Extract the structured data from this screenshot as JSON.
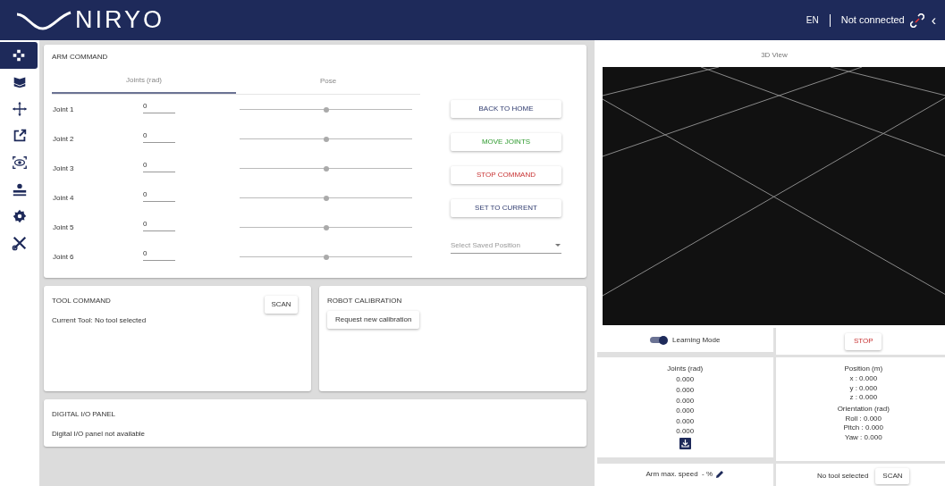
{
  "header": {
    "logo": "NIRYO",
    "language": "EN",
    "status": "Not connected",
    "collapse": "‹"
  },
  "sidebar": {
    "items": [
      {
        "selected": true
      },
      {
        "selected": false
      },
      {
        "selected": false
      },
      {
        "selected": false
      },
      {
        "selected": false
      },
      {
        "selected": false
      },
      {
        "selected": false
      },
      {
        "selected": false
      }
    ]
  },
  "arm_command": {
    "title": "ARM COMMAND",
    "tabs": [
      {
        "label": "Joints (rad)",
        "selected": true
      },
      {
        "label": "Pose",
        "selected": false
      }
    ],
    "joints": [
      {
        "label": "Joint 1",
        "value": "0",
        "level": 0.5
      },
      {
        "label": "Joint 2",
        "value": "0",
        "level": 0.5
      },
      {
        "label": "Joint 3",
        "value": "0",
        "level": 0.5
      },
      {
        "label": "Joint 4",
        "value": "0",
        "level": 0.5
      },
      {
        "label": "Joint 5",
        "value": "0",
        "level": 0.5
      },
      {
        "label": "Joint 6",
        "value": "0",
        "level": 0.5
      }
    ],
    "buttons": [
      {
        "label": "BACK TO HOME",
        "kind": "neutral"
      },
      {
        "label": "MOVE JOINTS",
        "kind": "go"
      },
      {
        "label": "STOP COMMAND",
        "kind": "stop"
      },
      {
        "label": "SET TO CURRENT",
        "kind": "neutral"
      }
    ],
    "saved_position": {
      "placeholder": "Select Saved Position"
    }
  },
  "tool_command": {
    "title": "TOOL COMMAND",
    "current_tool": "Current Tool: No tool selected",
    "button": "SCAN"
  },
  "robot_calibration": {
    "title": "ROBOT CALIBRATION",
    "button": "Request new calibration"
  },
  "digital_io": {
    "title": "DIGITAL I/O PANEL",
    "message": "Digital I/O panel not available"
  },
  "view_3d": {
    "title": "3D View"
  },
  "learning_mode": {
    "label": "Learning Mode",
    "on": true
  },
  "stop_button": "STOP",
  "joints_readout": {
    "title": "Joints (rad)",
    "values": [
      "0.000",
      "0.000",
      "0.000",
      "0.000",
      "0.000",
      "0.000"
    ]
  },
  "position": {
    "title": "Position (m)",
    "values": [
      "x : 0.000",
      "y : 0.000",
      "z : 0.000"
    ]
  },
  "orientation": {
    "title": "Orientation (rad)",
    "values": [
      "Roll : 0.000",
      "Pitch : 0.000",
      "Yaw : 0.000"
    ]
  },
  "arm_speed": {
    "label": "Arm max. speed  - %"
  },
  "tool_status": {
    "label": "No tool selected",
    "button": "SCAN"
  }
}
